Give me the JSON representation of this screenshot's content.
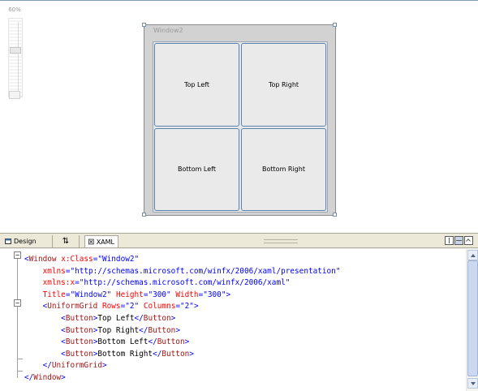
{
  "zoom": {
    "label": "60%",
    "level": 0.6
  },
  "window": {
    "title": "Window2"
  },
  "buttons": [
    {
      "label": "Top Left"
    },
    {
      "label": "Top Right"
    },
    {
      "label": "Bottom Left"
    },
    {
      "label": "Bottom Right"
    }
  ],
  "tabs": {
    "design": "Design",
    "swap": "⇅",
    "xaml": "XAML"
  },
  "icons": {
    "design": "design-view-icon",
    "swap": "swap-panes-icon",
    "xaml": "xaml-file-icon",
    "split_vertical": "split-vertical-icon",
    "split_horizontal": "split-horizontal-icon",
    "collapse": "collapse-pane-icon",
    "fold": "fold-toggle-icon"
  },
  "code": [
    {
      "seg": [
        [
          "punct",
          "<"
        ],
        [
          "tag",
          "Window"
        ],
        [
          "text",
          " "
        ],
        [
          "attr",
          "x:Class"
        ],
        [
          "punct",
          "=\""
        ],
        [
          "val",
          "Window2"
        ],
        [
          "punct",
          "\""
        ]
      ]
    },
    {
      "seg": [
        [
          "text",
          "    "
        ],
        [
          "attr",
          "xmlns"
        ],
        [
          "punct",
          "=\""
        ],
        [
          "val",
          "http://schemas.microsoft.com/winfx/2006/xaml/presentation"
        ],
        [
          "punct",
          "\""
        ]
      ]
    },
    {
      "seg": [
        [
          "text",
          "    "
        ],
        [
          "attr",
          "xmlns:x"
        ],
        [
          "punct",
          "=\""
        ],
        [
          "val",
          "http://schemas.microsoft.com/winfx/2006/xaml"
        ],
        [
          "punct",
          "\""
        ]
      ]
    },
    {
      "seg": [
        [
          "text",
          "    "
        ],
        [
          "attr",
          "Title"
        ],
        [
          "punct",
          "=\""
        ],
        [
          "val",
          "Window2"
        ],
        [
          "punct",
          "\""
        ],
        [
          "text",
          " "
        ],
        [
          "attr",
          "Height"
        ],
        [
          "punct",
          "=\""
        ],
        [
          "val",
          "300"
        ],
        [
          "punct",
          "\""
        ],
        [
          "text",
          " "
        ],
        [
          "attr",
          "Width"
        ],
        [
          "punct",
          "=\""
        ],
        [
          "val",
          "300"
        ],
        [
          "punct",
          "\">"
        ]
      ]
    },
    {
      "seg": [
        [
          "text",
          "    "
        ],
        [
          "punct",
          "<"
        ],
        [
          "tag",
          "UniformGrid"
        ],
        [
          "text",
          " "
        ],
        [
          "attr",
          "Rows"
        ],
        [
          "punct",
          "=\""
        ],
        [
          "val",
          "2"
        ],
        [
          "punct",
          "\""
        ],
        [
          "text",
          " "
        ],
        [
          "attr",
          "Columns"
        ],
        [
          "punct",
          "=\""
        ],
        [
          "val",
          "2"
        ],
        [
          "punct",
          "\">"
        ]
      ]
    },
    {
      "seg": [
        [
          "text",
          "        "
        ],
        [
          "punct",
          "<"
        ],
        [
          "tag",
          "Button"
        ],
        [
          "punct",
          ">"
        ],
        [
          "text",
          "Top Left"
        ],
        [
          "punct",
          "</"
        ],
        [
          "tag",
          "Button"
        ],
        [
          "punct",
          ">"
        ]
      ]
    },
    {
      "seg": [
        [
          "text",
          "        "
        ],
        [
          "punct",
          "<"
        ],
        [
          "tag",
          "Button"
        ],
        [
          "punct",
          ">"
        ],
        [
          "text",
          "Top Right"
        ],
        [
          "punct",
          "</"
        ],
        [
          "tag",
          "Button"
        ],
        [
          "punct",
          ">"
        ]
      ]
    },
    {
      "seg": [
        [
          "text",
          "        "
        ],
        [
          "punct",
          "<"
        ],
        [
          "tag",
          "Button"
        ],
        [
          "punct",
          ">"
        ],
        [
          "text",
          "Bottom Left"
        ],
        [
          "punct",
          "</"
        ],
        [
          "tag",
          "Button"
        ],
        [
          "punct",
          ">"
        ]
      ]
    },
    {
      "seg": [
        [
          "text",
          "        "
        ],
        [
          "punct",
          "<"
        ],
        [
          "tag",
          "Button"
        ],
        [
          "punct",
          ">"
        ],
        [
          "text",
          "Bottom Right"
        ],
        [
          "punct",
          "</"
        ],
        [
          "tag",
          "Button"
        ],
        [
          "punct",
          ">"
        ]
      ]
    },
    {
      "seg": [
        [
          "text",
          "    "
        ],
        [
          "punct",
          "</"
        ],
        [
          "tag",
          "UniformGrid"
        ],
        [
          "punct",
          ">"
        ]
      ]
    },
    {
      "seg": [
        [
          "punct",
          "</"
        ],
        [
          "tag",
          "Window"
        ],
        [
          "punct",
          ">"
        ]
      ]
    }
  ]
}
